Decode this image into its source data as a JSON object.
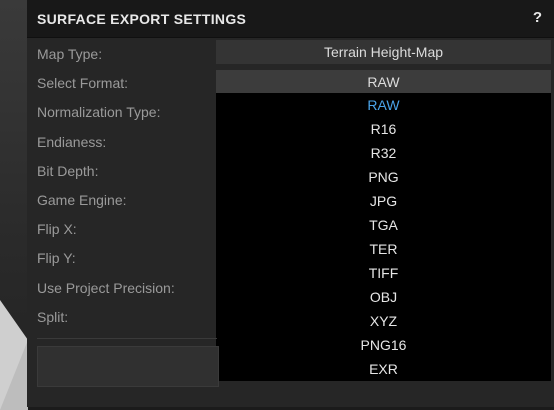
{
  "panel": {
    "title": "SURFACE EXPORT SETTINGS",
    "help_label": "?"
  },
  "labels": {
    "map_type": "Map Type:",
    "select_format": "Select Format:",
    "normalization_type": "Normalization Type:",
    "endianess": "Endianess:",
    "bit_depth": "Bit Depth:",
    "game_engine": "Game Engine:",
    "flip_x": "Flip X:",
    "flip_y": "Flip Y:",
    "use_project_precision": "Use Project Precision:",
    "split": "Split:"
  },
  "values": {
    "map_type": "Terrain Height-Map",
    "select_format": "RAW"
  },
  "format_options": [
    "RAW",
    "R16",
    "R32",
    "PNG",
    "JPG",
    "TGA",
    "TER",
    "TIFF",
    "OBJ",
    "XYZ",
    "PNG16",
    "EXR"
  ],
  "selected_option": "RAW",
  "colors": {
    "highlight": "#4aa3e8",
    "panel_bg": "#262626",
    "dropdown_bg": "#000000"
  }
}
